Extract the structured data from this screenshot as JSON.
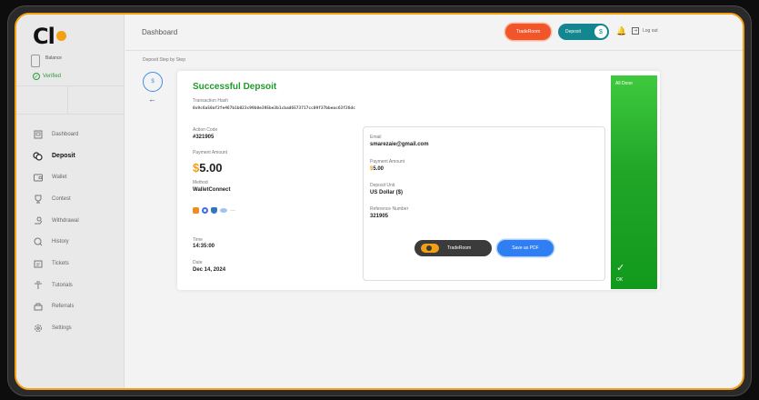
{
  "app": {
    "logo_text": "Cl"
  },
  "sidebar": {
    "balance_label": "Balance",
    "verified": "Verified",
    "items": [
      {
        "label": "Dashboard",
        "icon": "dashboard-icon"
      },
      {
        "label": "Deposit",
        "icon": "deposit-icon",
        "active": true
      },
      {
        "label": "Wallet",
        "icon": "wallet-icon"
      },
      {
        "label": "Contest",
        "icon": "trophy-icon"
      },
      {
        "label": "Withdrawal",
        "icon": "withdrawal-icon"
      },
      {
        "label": "History",
        "icon": "history-icon"
      },
      {
        "label": "Tickets",
        "icon": "ticket-icon"
      },
      {
        "label": "Tutorials",
        "icon": "tutorials-icon"
      },
      {
        "label": "Referrals",
        "icon": "referrals-icon"
      },
      {
        "label": "Settings",
        "icon": "settings-icon"
      }
    ]
  },
  "header": {
    "title": "Dashboard",
    "traderoom_button": "TradeRoom",
    "deposit_button": "Deposit",
    "deposit_knob": "$",
    "logout": "Log out"
  },
  "breadcrumb": "Deposit Step by Step",
  "step_badge": "$",
  "result": {
    "title": "Successful Depsoit",
    "hash_label": "Transaction Hash",
    "hash": "0x9c6a50af2fe467b1b023c99b0e395be3b1cbad6573717cc09f37bbeac63f26dc",
    "action_code_label": "Action Code",
    "action_code": "#321905",
    "payment_amount_label": "Payment Amount",
    "currency_symbol": "$",
    "payment_amount": "5.00",
    "method_label": "Method",
    "method": "WalletConnect",
    "more_wallets": "···",
    "time_label": "Time",
    "time": "14:35:00",
    "date_label": "Date",
    "date": "Dec 14, 2024",
    "email_label": "Email",
    "email": "smarezaie@gmail.com",
    "deposit_unit_label": "Deposit Unit",
    "deposit_unit": "US Dollar ($)",
    "reference_label": "Reference Number",
    "reference": "321905",
    "traderoom_button": "TradeRoom",
    "save_pdf_button": "Save as PDF",
    "all_done": "All Done",
    "ok": "OK"
  },
  "colors": {
    "accent": "#f3a014",
    "success": "#1f9a2c",
    "primary_blue": "#2f7ff2",
    "teal": "#13868f",
    "red_orange": "#f0562a"
  }
}
